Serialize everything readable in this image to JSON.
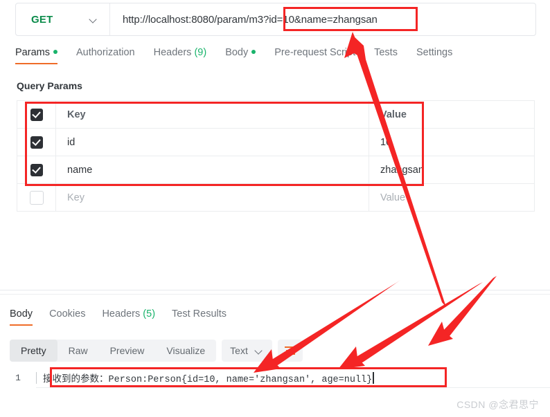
{
  "request": {
    "method": "GET",
    "method_chevron_icon": "chevron-down-icon",
    "url": "http://localhost:8080/param/m3?id=10&name=zhangsan",
    "tabs": [
      {
        "label": "Params",
        "dot": true,
        "active": true
      },
      {
        "label": "Authorization",
        "dot": false,
        "active": false
      },
      {
        "label": "Headers",
        "count": "(9)",
        "dot": false,
        "active": false
      },
      {
        "label": "Body",
        "dot": true,
        "active": false
      },
      {
        "label": "Pre-request Script",
        "dot": false,
        "active": false
      },
      {
        "label": "Tests",
        "dot": false,
        "active": false
      },
      {
        "label": "Settings",
        "dot": false,
        "active": false
      }
    ]
  },
  "query_params": {
    "section_title": "Query Params",
    "columns": {
      "key": "Key",
      "value": "Value"
    },
    "rows": [
      {
        "checked": true,
        "key": "id",
        "value": "10"
      },
      {
        "checked": true,
        "key": "name",
        "value": "zhangsan"
      }
    ],
    "empty_row": {
      "checked": false,
      "key_placeholder": "Key",
      "value_placeholder": "Value"
    }
  },
  "response": {
    "tabs": [
      {
        "label": "Body",
        "active": true
      },
      {
        "label": "Cookies",
        "active": false
      },
      {
        "label": "Headers",
        "count": "(5)",
        "active": false
      },
      {
        "label": "Test Results",
        "active": false
      }
    ],
    "view_modes": [
      {
        "label": "Pretty",
        "active": true
      },
      {
        "label": "Raw",
        "active": false
      },
      {
        "label": "Preview",
        "active": false
      },
      {
        "label": "Visualize",
        "active": false
      }
    ],
    "format": "Text",
    "format_chevron_icon": "chevron-down-icon",
    "wrap_icon": "text-wrap-icon",
    "line_number": "1",
    "body_text": "接收到的参数：Person:Person{id=10, name='zhangsan', age=null}"
  },
  "annotations": {
    "box_color": "#f42525",
    "arrow_color": "#f42525",
    "boxes": [
      {
        "name": "url-query-highlight"
      },
      {
        "name": "query-params-highlight"
      },
      {
        "name": "response-body-highlight"
      }
    ],
    "arrows": [
      {
        "name": "arrow-response-to-url"
      },
      {
        "name": "arrow-upperright-to-response-left"
      },
      {
        "name": "arrow-upperright-to-response-mid"
      }
    ]
  },
  "watermark": "CSDN @念君思宁"
}
